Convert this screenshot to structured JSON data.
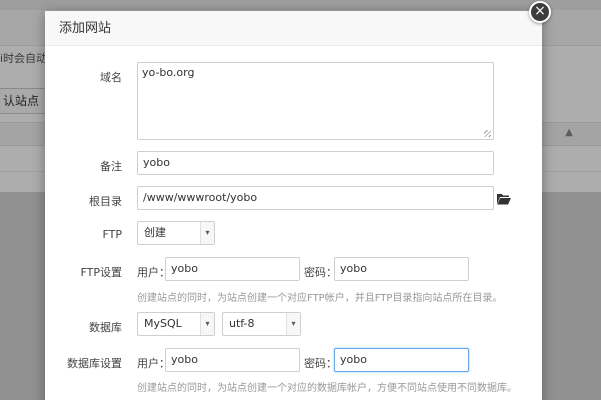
{
  "background": {
    "notice_text": "i时会自动",
    "default_site_button": "认站点"
  },
  "modal": {
    "title": "添加网站",
    "close_symbol": "×",
    "domain": {
      "label": "域名",
      "value": "yo-bo.org"
    },
    "remark": {
      "label": "备注",
      "value": "yobo"
    },
    "root_dir": {
      "label": "根目录",
      "value": "/www/wwwroot/yobo"
    },
    "ftp": {
      "label": "FTP",
      "selected": "创建"
    },
    "ftp_settings": {
      "label": "FTP设置",
      "user_label": "用户：",
      "user_value": "yobo",
      "password_label": "密码：",
      "password_value": "yobo",
      "hint": "创建站点的同时，为站点创建一个对应FTP帐户，并且FTP目录指向站点所在目录。"
    },
    "database": {
      "label": "数据库",
      "type_selected": "MySQL",
      "charset_selected": "utf-8"
    },
    "db_settings": {
      "label": "数据库设置",
      "user_label": "用户：",
      "user_value": "yobo",
      "password_label": "密码：",
      "password_value": "yobo",
      "hint": "创建站点的同时，为站点创建一个对应的数据库帐户，方便不同站点使用不同数据库。"
    }
  }
}
